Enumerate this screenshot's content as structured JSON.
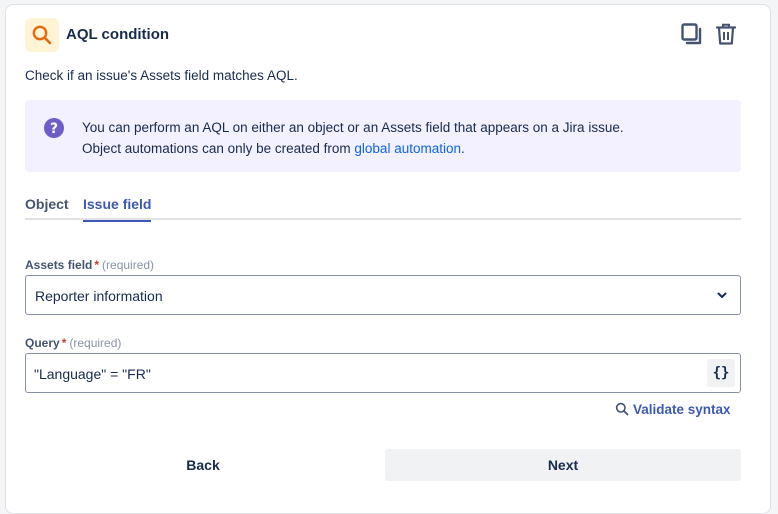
{
  "header": {
    "title": "AQL condition",
    "icon": "search-icon",
    "accent_color": "#e56910",
    "actions": [
      "copy-icon",
      "trash-icon"
    ]
  },
  "description": "Check if an issue's Assets field matches AQL.",
  "info": {
    "line1": "You can perform an AQL on either an object or an Assets field that appears on a Jira issue.",
    "line2_prefix": "Object automations can only be created from ",
    "link": "global automation",
    "line2_suffix": "."
  },
  "tabs": [
    {
      "label": "Object",
      "active": false
    },
    {
      "label": "Issue field",
      "active": true
    }
  ],
  "assets_field": {
    "label": "Assets field",
    "required_mark": "*",
    "required_hint": "(required)",
    "value": "Reporter information"
  },
  "query": {
    "label": "Query",
    "required_mark": "*",
    "required_hint": "(required)",
    "value": "\"Language\" = \"FR\"",
    "braces": "{}"
  },
  "validate_label": "Validate syntax",
  "buttons": {
    "back": "Back",
    "next": "Next"
  }
}
